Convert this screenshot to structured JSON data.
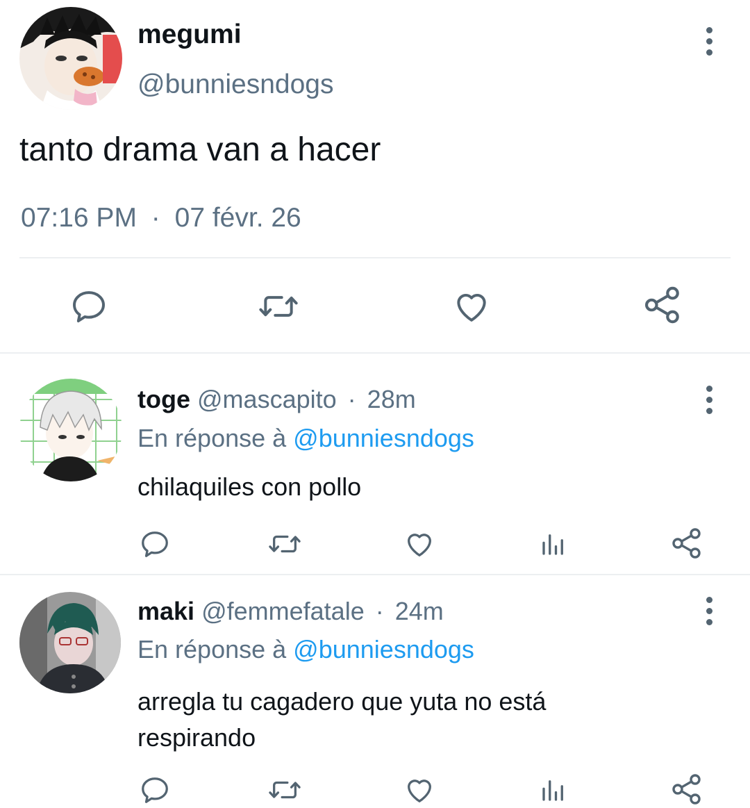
{
  "main_tweet": {
    "display_name": "megumi",
    "handle": "@bunniesndogs",
    "text": "tanto drama van a hacer",
    "time": "07:16 PM",
    "separator": "·",
    "date": "07 févr. 26",
    "actions": [
      "reply-icon",
      "retweet-icon",
      "like-icon",
      "share-icon"
    ]
  },
  "replies": [
    {
      "display_name": "toge",
      "handle": "@mascapito",
      "separator": "·",
      "time_ago": "28m",
      "reply_prefix": "En réponse à",
      "reply_to": "@bunniesndogs",
      "text_lines": [
        "chilaquiles con pollo"
      ]
    },
    {
      "display_name": "maki",
      "handle": "@femmefatale",
      "separator": "·",
      "time_ago": "24m",
      "reply_prefix": "En réponse à",
      "reply_to": "@bunniesndogs",
      "text_lines": [
        "arregla tu cagadero que yuta no está",
        "respirando"
      ]
    }
  ],
  "colors": {
    "text": "#0f1419",
    "muted": "#5b7083",
    "link": "#1d9bf0",
    "icon": "#536471",
    "divider": "#eceff1"
  }
}
